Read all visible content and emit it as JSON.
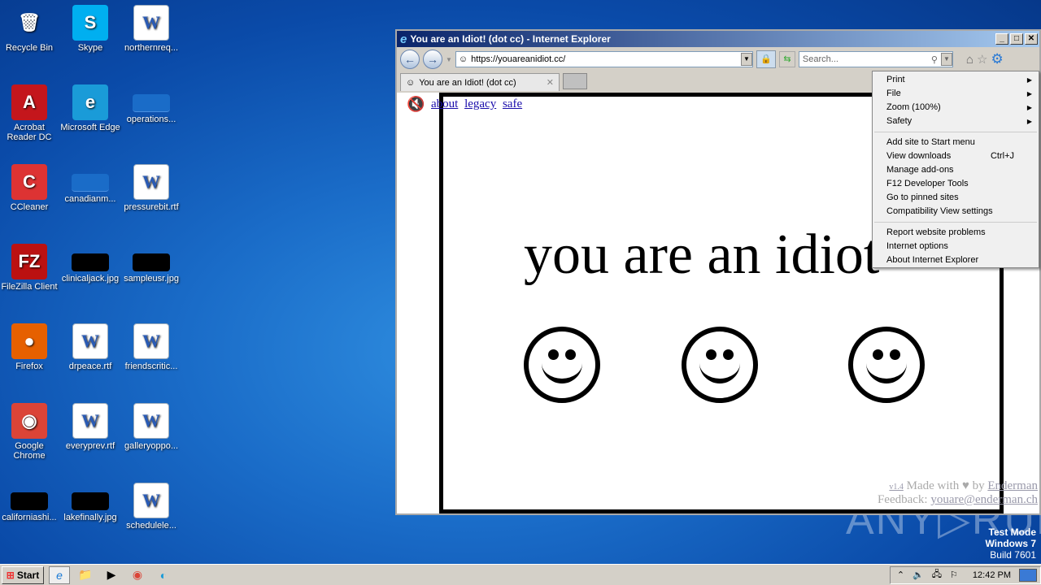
{
  "desktop": {
    "icons": [
      {
        "label": "Recycle Bin",
        "col": 0,
        "row": 0,
        "icon": "recycle-bin-icon",
        "glyph": "🗑",
        "bg": "transparent"
      },
      {
        "label": "Acrobat Reader DC",
        "col": 0,
        "row": 1,
        "icon": "acrobat-icon",
        "glyph": "A",
        "bg": "#c4161c"
      },
      {
        "label": "CCleaner",
        "col": 0,
        "row": 2,
        "icon": "ccleaner-icon",
        "glyph": "C",
        "bg": "#d33"
      },
      {
        "label": "FileZilla Client",
        "col": 0,
        "row": 3,
        "icon": "filezilla-icon",
        "glyph": "FZ",
        "bg": "#b11"
      },
      {
        "label": "Firefox",
        "col": 0,
        "row": 4,
        "icon": "firefox-icon",
        "glyph": "●",
        "bg": "#e66000"
      },
      {
        "label": "Google Chrome",
        "col": 0,
        "row": 5,
        "icon": "chrome-icon",
        "glyph": "◉",
        "bg": "#db4437"
      },
      {
        "label": "californiashi...",
        "col": 0,
        "row": 6,
        "icon": "image-file-icon",
        "type": "blk"
      },
      {
        "label": "Skype",
        "col": 1,
        "row": 0,
        "icon": "skype-icon",
        "glyph": "S",
        "bg": "#00aff0"
      },
      {
        "label": "Microsoft Edge",
        "col": 1,
        "row": 1,
        "icon": "edge-icon",
        "glyph": "e",
        "bg": "#1a9bd8"
      },
      {
        "label": "canadianm...",
        "col": 1,
        "row": 2,
        "icon": "file-icon",
        "type": "blu"
      },
      {
        "label": "clinicaljack.jpg",
        "col": 1,
        "row": 3,
        "icon": "image-file-icon",
        "type": "blk"
      },
      {
        "label": "drpeace.rtf",
        "col": 1,
        "row": 4,
        "icon": "word-doc-icon",
        "type": "doc"
      },
      {
        "label": "everyprev.rtf",
        "col": 1,
        "row": 5,
        "icon": "word-doc-icon",
        "type": "doc"
      },
      {
        "label": "lakefinally.jpg",
        "col": 1,
        "row": 6,
        "icon": "image-file-icon",
        "type": "blk"
      },
      {
        "label": "northernreq...",
        "col": 2,
        "row": 0,
        "icon": "word-doc-icon",
        "type": "doc"
      },
      {
        "label": "operations...",
        "col": 2,
        "row": 1,
        "icon": "file-icon",
        "type": "blu"
      },
      {
        "label": "pressurebit.rtf",
        "col": 2,
        "row": 2,
        "icon": "word-doc-icon",
        "type": "doc"
      },
      {
        "label": "sampleusr.jpg",
        "col": 2,
        "row": 3,
        "icon": "image-file-icon",
        "type": "blk"
      },
      {
        "label": "friendscritic...",
        "col": 2,
        "row": 4,
        "icon": "word-doc-icon",
        "type": "doc"
      },
      {
        "label": "galleryoppo...",
        "col": 2,
        "row": 5,
        "icon": "word-doc-icon",
        "type": "doc"
      },
      {
        "label": "schedulele...",
        "col": 2,
        "row": 6,
        "icon": "word-doc-icon",
        "type": "doc"
      }
    ]
  },
  "browser": {
    "title": "You are an Idiot! (dot cc) - Internet Explorer",
    "url": "https://youareanidiot.cc/",
    "search_placeholder": "Search...",
    "tab_label": "You are an Idiot! (dot cc)"
  },
  "page": {
    "links": [
      "about",
      "legacy",
      "safe"
    ],
    "headline": "you are an idiot",
    "version": "v1.4",
    "made_with": "Made with",
    "by": "by",
    "author": "Enderman",
    "feedback_label": "Feedback:",
    "email": "youare@enderman.ch"
  },
  "menu": {
    "items": [
      {
        "label": "Print",
        "submenu": true
      },
      {
        "label": "File",
        "submenu": true
      },
      {
        "label": "Zoom (100%)",
        "submenu": true
      },
      {
        "label": "Safety",
        "submenu": true
      },
      {
        "sep": true
      },
      {
        "label": "Add site to Start menu"
      },
      {
        "label": "View downloads",
        "shortcut": "Ctrl+J"
      },
      {
        "label": "Manage add-ons"
      },
      {
        "label": "F12 Developer Tools"
      },
      {
        "label": "Go to pinned sites"
      },
      {
        "label": "Compatibility View settings"
      },
      {
        "sep": true
      },
      {
        "label": "Report website problems"
      },
      {
        "label": "Internet options"
      },
      {
        "label": "About Internet Explorer"
      }
    ]
  },
  "taskbar": {
    "start": "Start",
    "clock": "12:42 PM"
  },
  "watermark": {
    "line1": "Test Mode",
    "line2": "Windows 7",
    "line3": "Build 7601",
    "brand": "ANY▷RUN"
  }
}
